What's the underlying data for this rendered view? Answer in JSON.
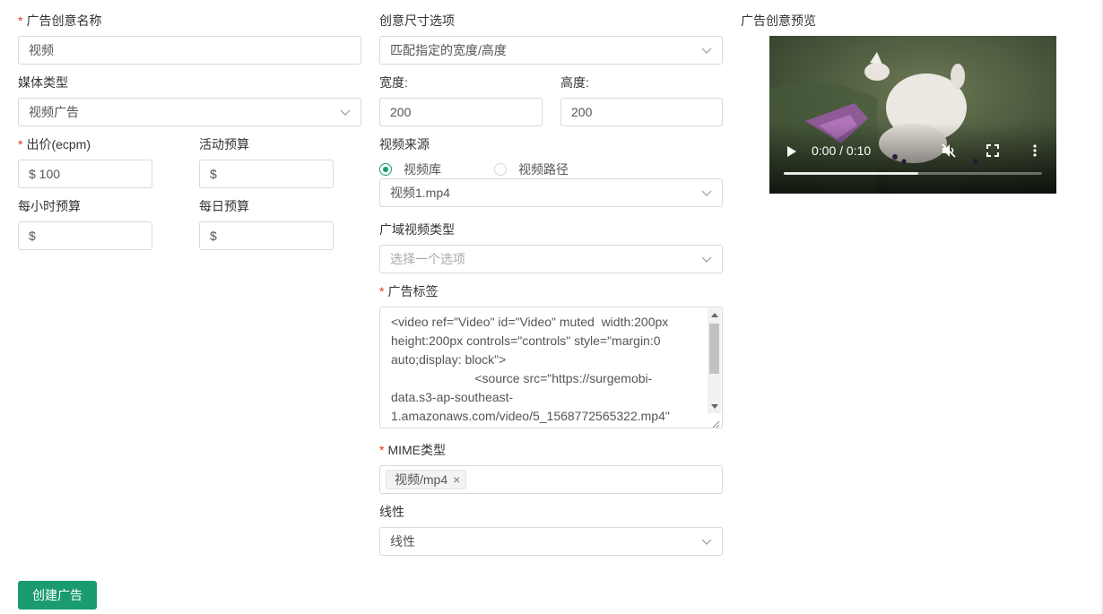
{
  "form": {
    "ad_name": {
      "label": "广告创意名称",
      "value": "视频"
    },
    "media_type": {
      "label": "媒体类型",
      "value": "视频广告"
    },
    "bid": {
      "label": "出价(ecpm)",
      "value": "$ 100"
    },
    "campaign_budget": {
      "label": "活动预算",
      "value": "$"
    },
    "hourly_budget": {
      "label": "每小时预算",
      "value": "$"
    },
    "daily_budget": {
      "label": "每日预算",
      "value": "$"
    },
    "size_option": {
      "label": "创意尺寸选项",
      "value": "匹配指定的宽度/高度"
    },
    "width": {
      "label": "宽度:",
      "value": "200"
    },
    "height": {
      "label": "高度:",
      "value": "200"
    },
    "video_source": {
      "label": "视频来源",
      "options": [
        "视频库",
        "视频路径"
      ],
      "selected": "视频库",
      "file": "视频1.mp4"
    },
    "wide_video_type": {
      "label": "广域视频类型",
      "placeholder": "选择一个选项"
    },
    "ad_tag": {
      "label": "广告标签",
      "lines": [
        "<video ref=\"Video\" id=\"Video\" muted  width:200px",
        "height:200px controls=\"controls\" style=\"margin:0",
        "auto;display: block\">",
        "                        <source src=\"https://surgemobi-",
        "data.s3-ap-southeast-",
        "1.amazonaws.com/video/5_1568772565322.mp4\""
      ]
    },
    "mime_type": {
      "label": "MIME类型",
      "tag": "视频/mp4",
      "tag_close": "×"
    },
    "linearity": {
      "label": "线性",
      "value": "线性"
    },
    "submit_label": "创建广告"
  },
  "preview": {
    "label": "广告创意预览",
    "time": "0:00 / 0:10",
    "progress": 0.52
  },
  "colors": {
    "accent": "#1a9c6e",
    "required": "#e5341c",
    "border": "#d9d9d9"
  },
  "icons": [
    "chevron-down-icon",
    "play-icon",
    "mute-icon",
    "fullscreen-icon",
    "more-icon",
    "close-icon",
    "resize-handle-icon"
  ]
}
